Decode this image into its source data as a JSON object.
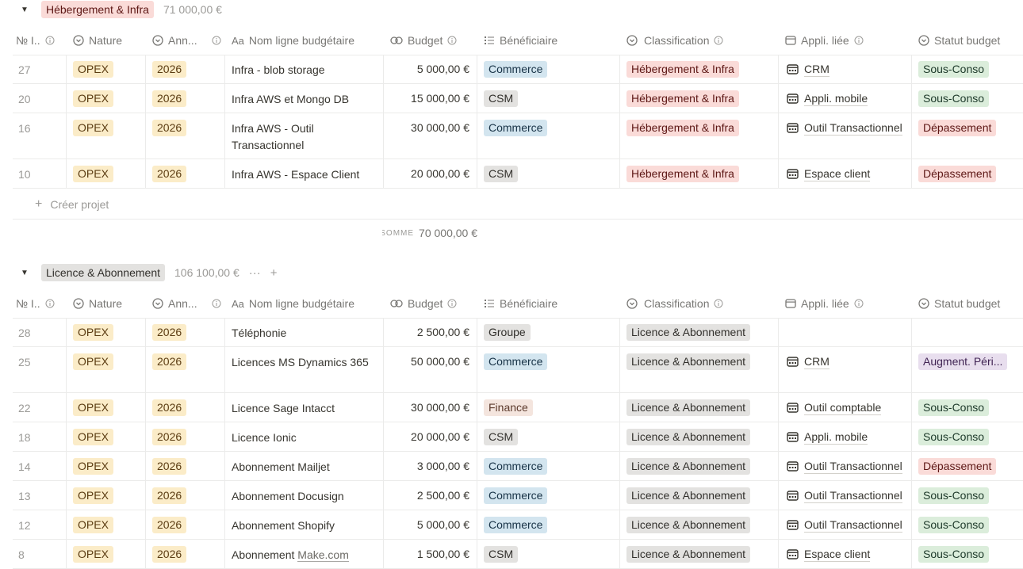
{
  "groups": [
    {
      "tag": "Hébergement & Infra",
      "sum": "71 000,00 €",
      "columns": [
        "№ I..",
        "Nature",
        "Ann...",
        "Nom ligne budgétaire",
        "Budget",
        "Bénéficiaire",
        "Classification",
        "Appli. liée",
        "Statut budget"
      ],
      "rows": [
        {
          "num": "27",
          "nature": "OPEX",
          "annee": "2026",
          "nom": "Infra - blob storage",
          "budget": "5 000,00 €",
          "benef": "Commerce",
          "classif": "Hébergement & Infra",
          "appli": "CRM",
          "statut": "Sous-Conso"
        },
        {
          "num": "20",
          "nature": "OPEX",
          "annee": "2026",
          "nom": "Infra AWS et Mongo DB",
          "budget": "15 000,00 €",
          "benef": "CSM",
          "classif": "Hébergement & Infra",
          "appli": "Appli. mobile",
          "statut": "Sous-Conso"
        },
        {
          "num": "16",
          "nature": "OPEX",
          "annee": "2026",
          "nom": "Infra AWS - Outil Transactionnel",
          "budget": "30 000,00 €",
          "benef": "Commerce",
          "classif": "Hébergement & Infra",
          "appli": "Outil Transactionnel",
          "statut": "Dépassement"
        },
        {
          "num": "10",
          "nature": "OPEX",
          "annee": "2026",
          "nom": "Infra AWS - Espace Client",
          "budget": "20 000,00 €",
          "benef": "CSM",
          "classif": "Hébergement & Infra",
          "appli": "Espace client",
          "statut": "Dépassement"
        }
      ],
      "new_label": "Créer projet",
      "sum_label": "SOMME",
      "sum_value": "70 000,00 €"
    },
    {
      "tag": "Licence & Abonnement",
      "sum": "106 100,00 €",
      "more": "···",
      "add": "+",
      "columns": [
        "№ I..",
        "Nature",
        "Ann...",
        "Nom ligne budgétaire",
        "Budget",
        "Bénéficiaire",
        "Classification",
        "Appli. liée",
        "Statut budget"
      ],
      "rows": [
        {
          "num": "28",
          "nature": "OPEX",
          "annee": "2026",
          "nom": "Téléphonie",
          "budget": "2 500,00 €",
          "benef": "Groupe",
          "classif": "Licence & Abonnement",
          "appli": "",
          "statut": ""
        },
        {
          "num": "25",
          "nature": "OPEX",
          "annee": "2026",
          "nom": "Licences MS Dynamics 365",
          "budget": "50 000,00 €",
          "benef": "Commerce",
          "classif": "Licence & Abonnement",
          "appli": "CRM",
          "statut": "Augment. Péri..."
        },
        {
          "num": "22",
          "nature": "OPEX",
          "annee": "2026",
          "nom": "Licence Sage Intacct",
          "budget": "30 000,00 €",
          "benef": "Finance",
          "classif": "Licence & Abonnement",
          "appli": "Outil comptable",
          "statut": "Sous-Conso"
        },
        {
          "num": "18",
          "nature": "OPEX",
          "annee": "2026",
          "nom": "Licence Ionic",
          "budget": "20 000,00 €",
          "benef": "CSM",
          "classif": "Licence & Abonnement",
          "appli": "Appli. mobile",
          "statut": "Sous-Conso"
        },
        {
          "num": "14",
          "nature": "OPEX",
          "annee": "2026",
          "nom": "Abonnement Mailjet",
          "budget": "3 000,00 €",
          "benef": "Commerce",
          "classif": "Licence & Abonnement",
          "appli": "Outil Transactionnel",
          "statut": "Dépassement"
        },
        {
          "num": "13",
          "nature": "OPEX",
          "annee": "2026",
          "nom": "Abonnement Docusign",
          "budget": "2 500,00 €",
          "benef": "Commerce",
          "classif": "Licence & Abonnement",
          "appli": "Outil Transactionnel",
          "statut": "Sous-Conso"
        },
        {
          "num": "12",
          "nature": "OPEX",
          "annee": "2026",
          "nom": "Abonnement Shopify",
          "budget": "5 000,00 €",
          "benef": "Commerce",
          "classif": "Licence & Abonnement",
          "appli": "Outil Transactionnel",
          "statut": "Sous-Conso"
        },
        {
          "num": "8",
          "nature": "OPEX",
          "annee": "2026",
          "nom": "Abonnement ",
          "nom_link": "Make.com",
          "budget": "1 500,00 €",
          "benef": "CSM",
          "classif": "Licence & Abonnement",
          "appli": "Espace client",
          "statut": "Sous-Conso"
        }
      ]
    }
  ],
  "colors": {
    "group1_tag_bg": "#fadbd8",
    "group2_tag_bg": "#e3e2e0",
    "border": "#ebebea"
  }
}
